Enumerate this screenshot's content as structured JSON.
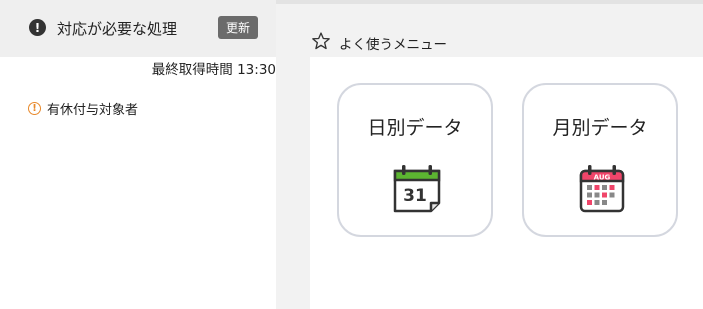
{
  "left": {
    "title": "対応が必要な処理",
    "refresh_label": "更新",
    "last_fetch": "最終取得時間 13:30",
    "items": [
      {
        "label": "有休付与対象者",
        "icon": "warning-circle-icon",
        "color": "#e8892b"
      }
    ]
  },
  "right": {
    "title": "よく使うメニュー",
    "tiles": [
      {
        "label": "日別データ",
        "icon": "calendar-day-icon",
        "icon_text": "31",
        "accent": "#5cb531"
      },
      {
        "label": "月別データ",
        "icon": "calendar-month-icon",
        "icon_text": "AUG",
        "accent": "#f0456a"
      }
    ]
  }
}
